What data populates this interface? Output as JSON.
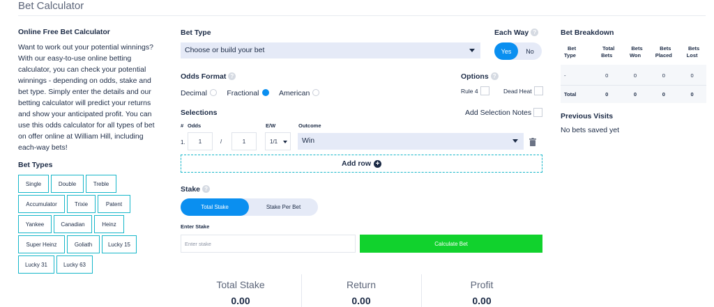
{
  "page": {
    "title": "Bet Calculator"
  },
  "intro": {
    "heading": "Online Free Bet Calculator",
    "body": "Want to work out your potential winnings? With our easy-to-use online betting calculator, you can check your potential winnings - depending on odds, stake and bet type. Simply enter the details and our betting calculator will predict your returns and show your anticipated profit. You can use this odds calculator for all types of bet on offer online at William Hill, including each-way bets!"
  },
  "bet_types": {
    "heading": "Bet Types",
    "items": [
      "Single",
      "Double",
      "Treble",
      "Accumulator",
      "Trixie",
      "Patent",
      "Yankee",
      "Canadian",
      "Heinz",
      "Super Heinz",
      "Goliath",
      "Lucky 15",
      "Lucky 31",
      "Lucky 63"
    ]
  },
  "bet_type": {
    "label": "Bet Type",
    "selected": "Choose or build your bet"
  },
  "each_way": {
    "label": "Each Way",
    "yes": "Yes",
    "no": "No",
    "value": "Yes"
  },
  "odds_format": {
    "label": "Odds Format",
    "options": [
      "Decimal",
      "Fractional",
      "American"
    ],
    "selected": "Fractional"
  },
  "options": {
    "label": "Options",
    "rule4": "Rule 4",
    "dead_heat": "Dead Heat"
  },
  "selections": {
    "label": "Selections",
    "add_notes": "Add Selection Notes",
    "col_num": "#",
    "col_odds": "Odds",
    "col_ew": "E/W",
    "col_outcome": "Outcome",
    "rows": [
      {
        "num": "1.",
        "odds_num": "1",
        "odds_sep": "/",
        "odds_den": "1",
        "ew": "1/1",
        "outcome": "Win"
      }
    ],
    "add_row": "Add row"
  },
  "stake": {
    "label": "Stake",
    "tab_total": "Total Stake",
    "tab_per_bet": "Stake Per Bet",
    "selected_tab": "Total Stake",
    "enter_label": "Enter Stake",
    "placeholder": "Enter stake",
    "calculate": "Calculate Bet"
  },
  "summary": {
    "total_stake_label": "Total Stake",
    "total_stake": "0.00",
    "return_label": "Return",
    "return": "0.00",
    "profit_label": "Profit",
    "profit": "0.00"
  },
  "breakdown": {
    "heading": "Bet Breakdown",
    "headers": [
      [
        "Bet",
        "Type"
      ],
      [
        "Total",
        "Bets"
      ],
      [
        "Bets",
        "Won"
      ],
      [
        "Bets",
        "Placed"
      ],
      [
        "Bets",
        "Lost"
      ]
    ],
    "rows": [
      [
        "-",
        "0",
        "0",
        "0",
        "0"
      ],
      [
        "Total",
        "0",
        "0",
        "0",
        "0"
      ]
    ]
  },
  "previous_visits": {
    "heading": "Previous Visits",
    "empty": "No bets saved yet"
  },
  "colors": {
    "accent": "#0a8ff0",
    "teal_border": "#14b6c9",
    "calc_green": "#11d22d",
    "select_bg": "#e5eaf7"
  }
}
